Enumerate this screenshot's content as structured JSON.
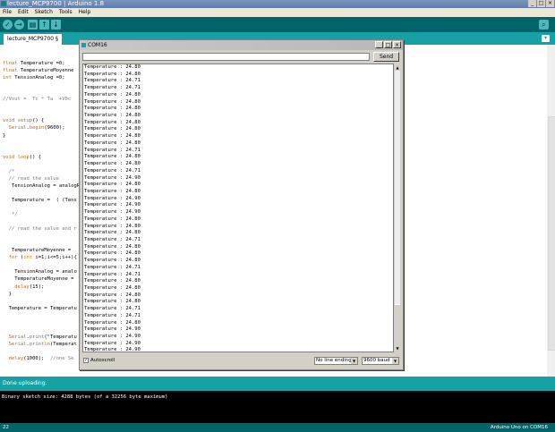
{
  "window": {
    "title": "lecture_MCP9700 | Arduino 1.8",
    "controls": [
      "_",
      "□",
      "×"
    ]
  },
  "menu": [
    "File",
    "Edit",
    "Sketch",
    "Tools",
    "Help"
  ],
  "toolbar": {
    "verify": "✓",
    "upload": "→",
    "new": "▤",
    "open": "↑",
    "save": "↓",
    "serial_monitor": "⌕"
  },
  "tab": {
    "label": "lecture_MCP9700 §",
    "menu": "▾"
  },
  "code_lines": [
    "",
    "float Temperature =0;",
    "float TemperatureMoyenne",
    "int TensionAnalog =0;",
    "",
    "",
    "//Vout =  Tc * Ta  +V0c",
    "",
    "",
    "void setup() {",
    "  Serial.begin(9600);",
    "}",
    "",
    "",
    "void loop() {",
    "",
    "  /*",
    "  // read the value",
    "   TensionAnalog = analogR",
    "",
    "   Temperature =  ( (Tens",
    "",
    "   */",
    "",
    "  // read the value and r",
    "",
    "",
    "   TemperatureMoyenne =",
    "  for (int i=1;i<=5;i++){",
    "",
    "    TensionAnalog = analo",
    "    TemperatureMoyenne =",
    "    delay(15);",
    "  }",
    "",
    "  Temperature = Temperatu",
    "",
    "",
    "",
    "  Serial.print(\"Temperatu",
    "  Serial.println(Temperat",
    "",
    "  delay(1000);  //one Se",
    "",
    "",
    "",
    "}"
  ],
  "status": {
    "message": "Done uploading."
  },
  "console": {
    "line": "Binary sketch size: 4288 bytes (of a 32256 byte maximum)"
  },
  "footer": {
    "line_number": "22",
    "board": "Arduino Uno on COM16"
  },
  "serial_monitor": {
    "title": "COM16",
    "controls": [
      "_",
      "□",
      "×"
    ],
    "input_value": "",
    "send_label": "Send",
    "lines": [
      "Temperature : 24.80",
      "Temperature : 24.80",
      "Temperature : 24.71",
      "Temperature : 24.71",
      "Temperature : 24.80",
      "Temperature : 24.80",
      "Temperature : 24.80",
      "Temperature : 24.80",
      "Temperature : 24.80",
      "Temperature : 24.80",
      "Temperature : 24.80",
      "Temperature : 24.80",
      "Temperature : 24.71",
      "Temperature : 24.80",
      "Temperature : 24.80",
      "Temperature : 24.71",
      "Temperature : 24.90",
      "Temperature : 24.80",
      "Temperature : 24.80",
      "Temperature : 24.90",
      "Temperature : 24.90",
      "Temperature : 24.90",
      "Temperature : 24.80",
      "Temperature : 24.80",
      "Temperature : 24.80",
      "Temperature : 24.71",
      "Temperature : 24.80",
      "Temperature : 24.80",
      "Temperature : 24.80",
      "Temperature : 24.71",
      "Temperature : 24.71",
      "Temperature : 24.80",
      "Temperature : 24.80",
      "Temperature : 24.80",
      "Temperature : 24.80",
      "Temperature : 24.71",
      "Temperature : 24.71",
      "Temperature : 24.80",
      "Temperature : 24.90",
      "Temperature : 24.90",
      "Temperature : 24.90",
      "Temperature : 24.90",
      "Temperatu"
    ],
    "autoscroll_label": "Autoscroll",
    "autoscroll_checked": "✓",
    "line_ending": "No line ending",
    "baud": "9600 baud"
  },
  "colors": {
    "toolbar": "#006468",
    "tabbar": "#17a1a5",
    "button": "#4db7bb"
  }
}
